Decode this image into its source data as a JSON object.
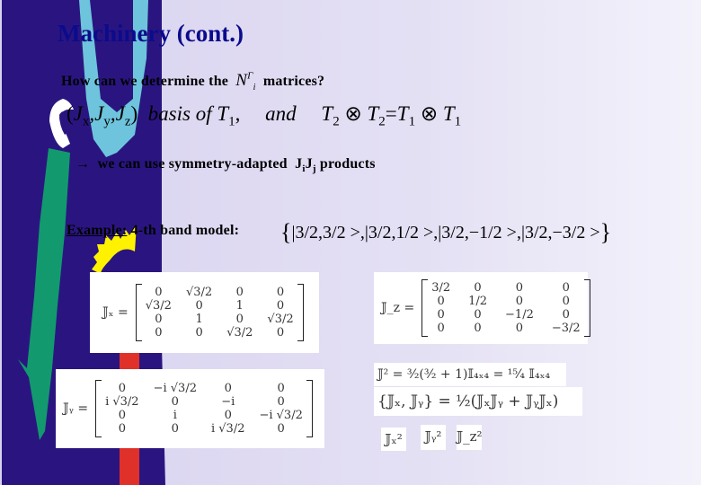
{
  "slide": {
    "title": "Machinery (cont.)",
    "question": {
      "prefix": "How can we determine the",
      "symbol_base": "N",
      "symbol_sup": "Γ",
      "symbol_sub": "i",
      "suffix": "matrices?"
    },
    "basis_line": {
      "open": "(",
      "jx": "J",
      "jx_sub": "x",
      "jy": "J",
      "jy_sub": "y",
      "jz": "J",
      "jz_sub": "z",
      "close": ")",
      "basis_text": "basis of T",
      "basis_sub": "1",
      "comma": ",",
      "and": "and",
      "t2a": "T",
      "t2a_sub": "2",
      "otimes1": "⊗",
      "t2b": "T",
      "t2b_sub": "2",
      "equals": "=",
      "t1a": "T",
      "t1a_sub": "1",
      "otimes2": "⊗",
      "t1b": "T",
      "t1b_sub": "1"
    },
    "arrow_line": {
      "arrow": "→",
      "text": "we can use symmetry-adapted",
      "ji": "J",
      "ji_sub": "i",
      "jj": "J",
      "jj_sub": "j",
      "suffix": "products"
    },
    "example": {
      "label": "Example:",
      "text": "4-th band model:",
      "brace_open": "{",
      "kets": "|3/2,3/2 >,|3/2,1/2 >,|3/2,−1/2 >,|3/2,−3/2 >",
      "brace_close": "}"
    },
    "matrices": {
      "jx": {
        "lhs": "𝕁ₓ =",
        "cells": [
          "0",
          "√3/2",
          "0",
          "0",
          "√3/2",
          "0",
          "1",
          "0",
          "0",
          "1",
          "0",
          "√3/2",
          "0",
          "0",
          "√3/2",
          "0"
        ]
      },
      "jy": {
        "lhs": "𝕁ᵧ =",
        "cells": [
          "0",
          "−i √3/2",
          "0",
          "0",
          "i √3/2",
          "0",
          "−i",
          "0",
          "0",
          "i",
          "0",
          "−i √3/2",
          "0",
          "0",
          "i √3/2",
          "0"
        ]
      },
      "jz": {
        "lhs": "𝕁_z =",
        "cells": [
          "3/2",
          "0",
          "0",
          "0",
          "0",
          "1/2",
          "0",
          "0",
          "0",
          "0",
          "−1/2",
          "0",
          "0",
          "0",
          "0",
          "−3/2"
        ]
      }
    },
    "equations": {
      "j_squared": "𝕁² = ³⁄₂(³⁄₂ + 1)𝕀₄ₓ₄ = ¹⁵⁄₄ 𝕀₄ₓ₄",
      "anticommutator": "{𝕁ₓ, 𝕁ᵧ} =  ½(𝕁ₓ𝕁ᵧ + 𝕁ᵧ𝕁ₓ)",
      "squares": [
        "𝕁ₓ²",
        "𝕁ᵧ²",
        "𝕁_z²"
      ]
    },
    "colors": {
      "title": "#0b0b8c",
      "background_left": "#d8d2ef",
      "background_right": "#f3f2fb",
      "deco_navy": "#2a1580",
      "deco_lightblue": "#6ec4dc",
      "deco_green": "#129a6e",
      "deco_yellow": "#fff200",
      "deco_red": "#e0302a",
      "deco_white": "#ffffff"
    }
  }
}
